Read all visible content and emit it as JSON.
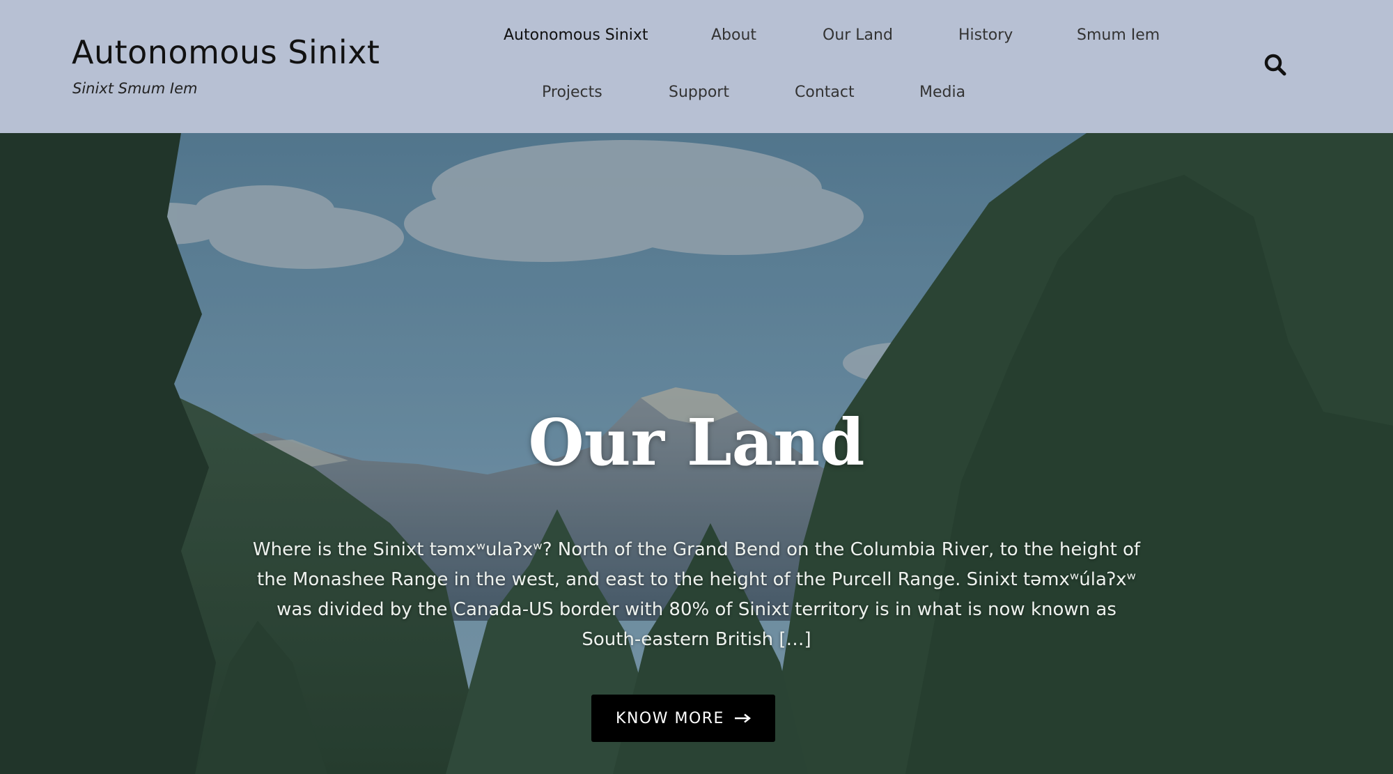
{
  "site": {
    "title": "Autonomous Sinixt",
    "tagline": "Sinixt Smum Iem"
  },
  "nav": {
    "row1": [
      "Autonomous Sinixt",
      "About",
      "Our Land",
      "History",
      "Smum Iem"
    ],
    "row2": [
      "Projects",
      "Support",
      "Contact",
      "Media"
    ],
    "active": "Autonomous Sinixt"
  },
  "search": {
    "icon": "search-icon"
  },
  "hero": {
    "title": "Our Land",
    "excerpt": "Where is the Sinixt təmxʷulaʔxʷ? North of the Grand Bend on the Columbia River, to the height of the Monashee Range in the west, and east to the height of the Purcell Range. Sinixt təmxʷúlaʔxʷ was divided by the Canada-US border with 80% of Sinixt territory is in what is now known as South-eastern British […]",
    "cta_label": "KNOW MORE",
    "cta_icon": "arrow-right-icon"
  },
  "colors": {
    "header_bg": "#b7c0d3",
    "cta_bg": "#000000",
    "hero_text": "#ffffff"
  }
}
